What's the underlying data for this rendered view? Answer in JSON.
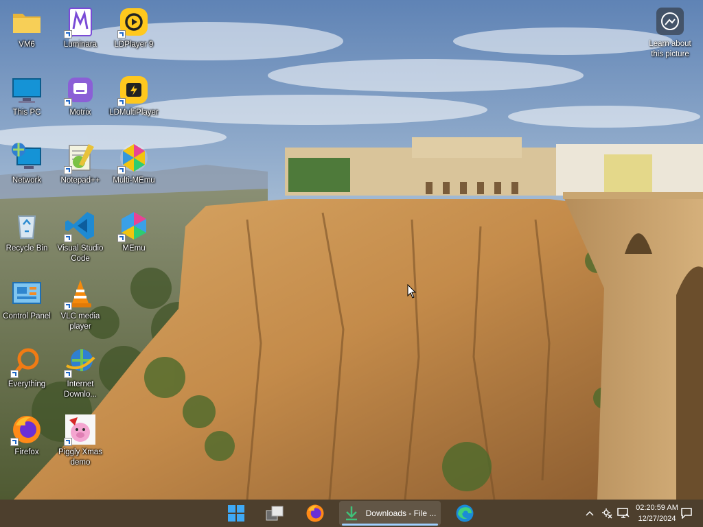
{
  "desktop": {
    "icons": [
      {
        "label": "VM6"
      },
      {
        "label": "Luminara"
      },
      {
        "label": "LDPlayer 9"
      },
      {
        "label": "This PC"
      },
      {
        "label": "Motrix"
      },
      {
        "label": "LDMultiPlayer"
      },
      {
        "label": "Network"
      },
      {
        "label": "Notepad++"
      },
      {
        "label": "Multi-MEmu"
      },
      {
        "label": "Recycle Bin"
      },
      {
        "label": "Visual Studio Code"
      },
      {
        "label": "MEmu"
      },
      {
        "label": "Control Panel"
      },
      {
        "label": "VLC media player"
      },
      {
        "label": "Everything"
      },
      {
        "label": "Internet Downlo..."
      },
      {
        "label": "Firefox"
      },
      {
        "label": "Piggly Xmas demo"
      }
    ],
    "learn_about": "Learn about this picture"
  },
  "taskbar": {
    "active_window": "Downloads - File ...",
    "time": "02:20:59 AM",
    "date": "12/27/2024"
  },
  "colors": {
    "taskbar_bg": "#4d3f2d",
    "accent": "#9fd0ff"
  }
}
